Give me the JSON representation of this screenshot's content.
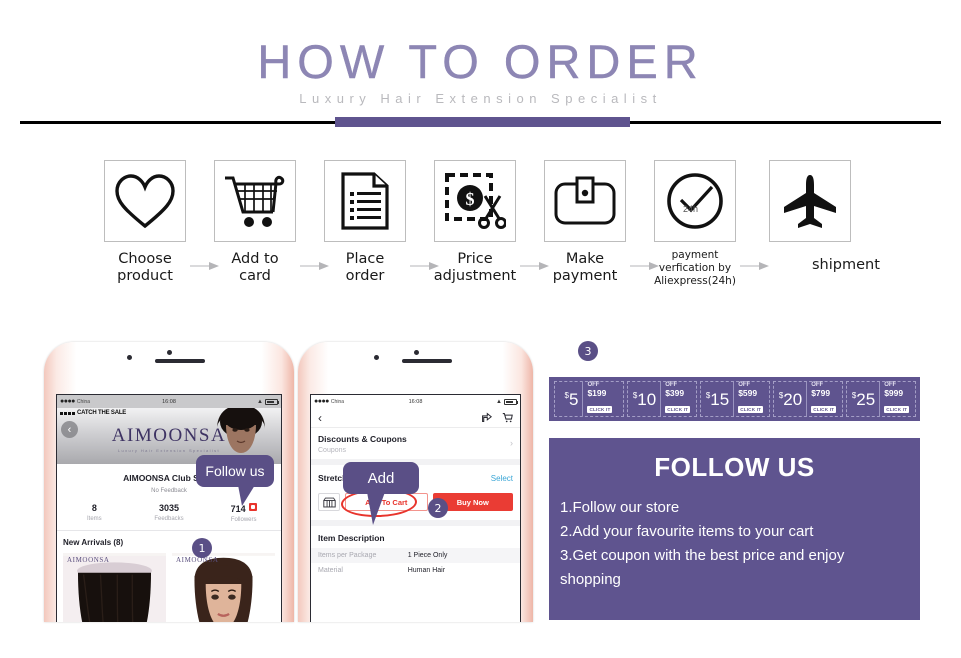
{
  "header": {
    "title": "HOW TO ORDER",
    "subtitle": "Luxury Hair Extension Specialist",
    "accent_color": "#5f548f",
    "title_color": "#8d86b4"
  },
  "flow": {
    "steps": [
      {
        "icon": "heart-icon",
        "label_line1": "Choose",
        "label_line2": "product"
      },
      {
        "icon": "cart-icon",
        "label_line1": "Add to",
        "label_line2": "card"
      },
      {
        "icon": "document-icon",
        "label_line1": "Place",
        "label_line2": "order"
      },
      {
        "icon": "price-scissors-icon",
        "label_line1": "Price",
        "label_line2": "adjustment"
      },
      {
        "icon": "wallet-icon",
        "label_line1": "Make",
        "label_line2": "payment"
      },
      {
        "icon": "clock-check-icon",
        "clock_text": "24h",
        "label_line1": "payment",
        "label_line2": "verfication by",
        "label_line3": "Aliexpress(24h)"
      },
      {
        "icon": "airplane-icon",
        "label_line1": "shipment",
        "label_line2": ""
      }
    ],
    "arrow_icon": "arrow-right-icon"
  },
  "phone_left": {
    "status_bar": {
      "carrier": "China",
      "time": "16:08",
      "wifi": "wifi-icon",
      "battery": "battery-icon"
    },
    "sale_badge": "CATCH THE SALE",
    "back_icon": "back-chevron-icon",
    "brand_name": "AIMOONSA",
    "brand_tagline": "Luxury Hair Extension Specialist",
    "store_name": "AIMOONSA Club Store",
    "feedback": "No Feedback",
    "stats": [
      {
        "value": "8",
        "label": "Items"
      },
      {
        "value": "3035",
        "label": "Feedbacks"
      },
      {
        "value": "714",
        "label": "Followers"
      }
    ],
    "new_arrivals": "New Arrivals (8)",
    "tile_watermark": "AIMOONSA",
    "bubble": "Follow us",
    "badge": "1"
  },
  "phone_right": {
    "status_bar": {
      "carrier": "China",
      "time": "16:08",
      "wifi": "wifi-icon",
      "battery": "battery-icon"
    },
    "back_icon": "back-chevron-icon",
    "share_icon": "share-icon",
    "cart_icon": "cart-icon",
    "coupons_title": "Discounts & Coupons",
    "coupons_sub": "Coupons",
    "length_label": "Stretched Length",
    "select_label": "Select",
    "store_icon": "store-icon",
    "add_to_cart": "Add To Cart",
    "buy_now": "Buy Now",
    "desc_title": "Item Description",
    "desc_rows": [
      {
        "key": "Items per Package",
        "value": "1 Piece Only"
      },
      {
        "key": "Material",
        "value": "Human Hair"
      }
    ],
    "bubble": "Add",
    "badge": "2"
  },
  "coupons": {
    "badge": "3",
    "items": [
      {
        "amount": "5",
        "currency": "$",
        "off": "OFF",
        "min": "$199",
        "cta": "CLICK IT"
      },
      {
        "amount": "10",
        "currency": "$",
        "off": "OFF",
        "min": "$399",
        "cta": "CLICK IT"
      },
      {
        "amount": "15",
        "currency": "$",
        "off": "OFF",
        "min": "$599",
        "cta": "CLICK IT"
      },
      {
        "amount": "20",
        "currency": "$",
        "off": "OFF",
        "min": "$799",
        "cta": "CLICK IT"
      },
      {
        "amount": "25",
        "currency": "$",
        "off": "OFF",
        "min": "$999",
        "cta": "CLICK IT"
      }
    ]
  },
  "follow_panel": {
    "title": "FOLLOW US",
    "lines": [
      "1.Follow our store",
      "2.Add your favourite items to your cart",
      "3.Get coupon with the best price and enjoy",
      "shopping"
    ],
    "background": "#5f548f"
  }
}
